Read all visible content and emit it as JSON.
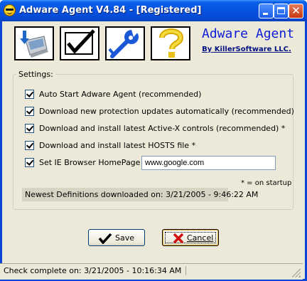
{
  "window": {
    "title": "Adware Agent V4.84 - [Registered]",
    "title_bar_color": "#0a5fe8"
  },
  "toolbar": {
    "icons": [
      "scan-computer-icon",
      "checkmark-icon",
      "wrench-tools-icon",
      "question-help-icon"
    ]
  },
  "brand": {
    "name": "Adware Agent",
    "byline": "By KillerSoftware LLC.",
    "name_color": "#1020d8"
  },
  "settings": {
    "legend": "Settings:",
    "options": [
      {
        "label": "Auto Start Adware Agent  (recommended)",
        "checked": true
      },
      {
        "label": "Download new protection updates automatically  (recommended)",
        "checked": true
      },
      {
        "label": "Download and install latest Active-X controls  (recommended)  *",
        "checked": true
      },
      {
        "label": "Download and install latest HOSTS file  *",
        "checked": true
      },
      {
        "label": "Set IE Browser HomePage to:",
        "checked": true
      }
    ],
    "homepage_value": "www.google.com",
    "startup_note": "* = on startup",
    "definitions_status": "Newest Definitions downloaded on: 3/21/2005 - 9:46:22 AM"
  },
  "buttons": {
    "save_label": "Save",
    "cancel_label": "Cancel"
  },
  "status_bar": {
    "text": "Check complete on: 3/21/2005 - 10:16:34 AM"
  }
}
